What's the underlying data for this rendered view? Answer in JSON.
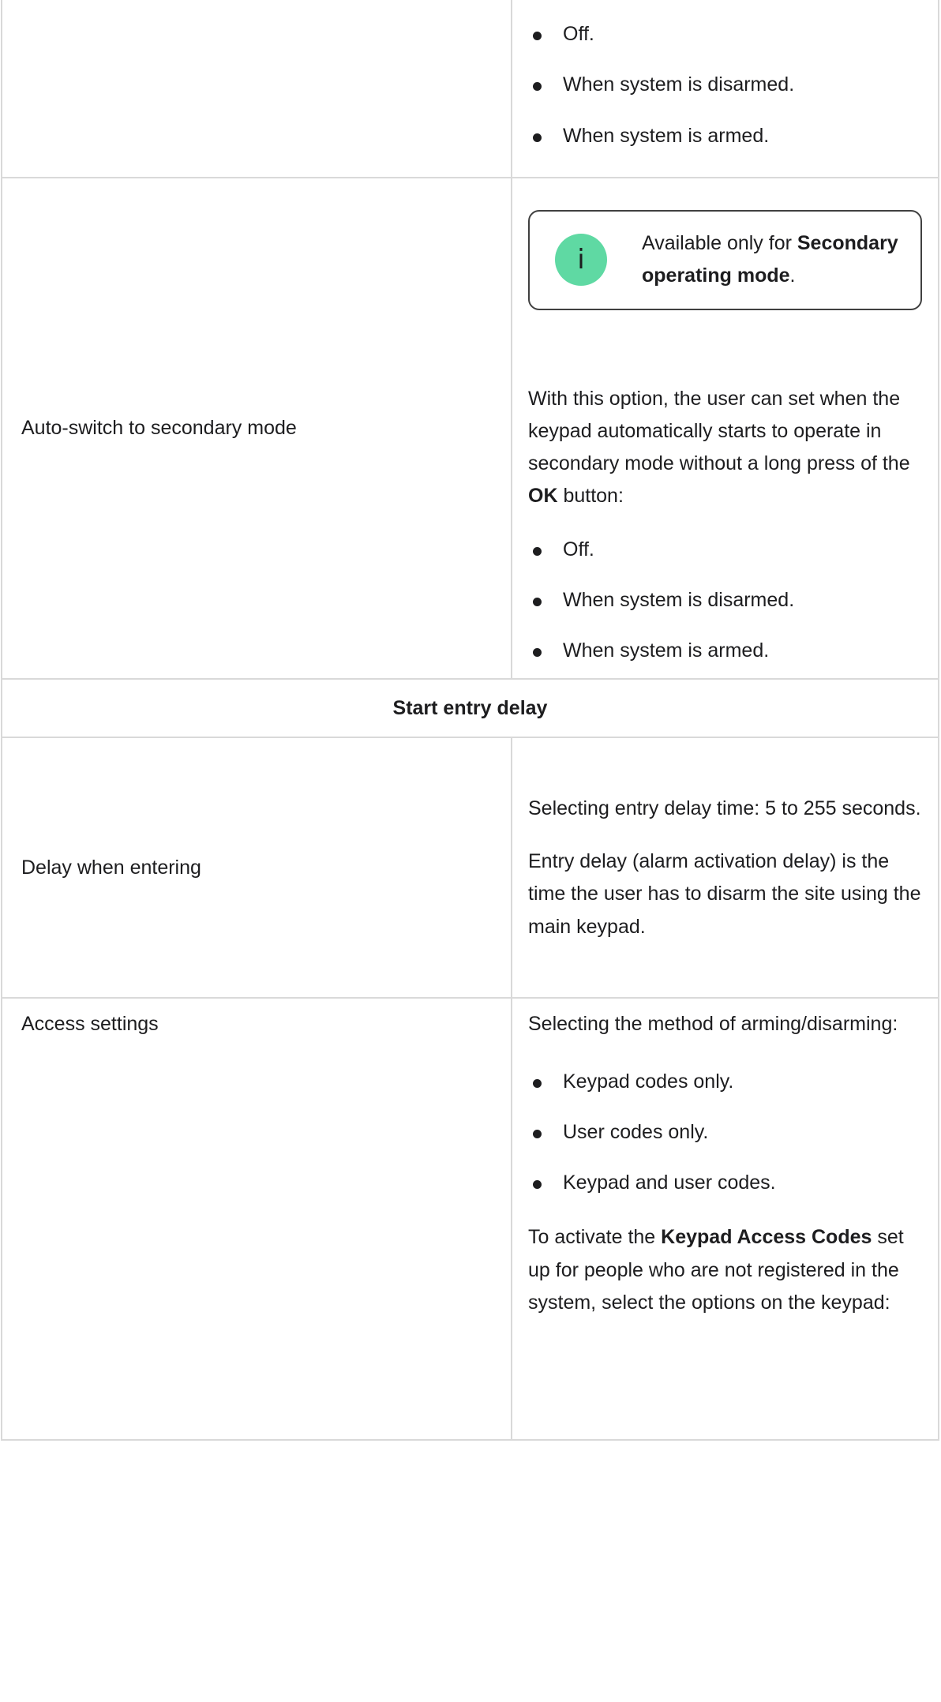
{
  "rows": {
    "arming_light_cont": {
      "options": [
        "Off.",
        "When system is disarmed.",
        "When system is armed."
      ]
    },
    "auto_switch": {
      "name": "Auto-switch to secondary mode",
      "note_prefix": "Available only for ",
      "note_bold": "Secondary operating mode",
      "note_suffix": ".",
      "note_icon": "info-icon",
      "desc_prefix": "With this option, the user can set when the keypad automatically starts to operate in secondary mode without a long press of the ",
      "desc_bold": "OK",
      "desc_suffix": " button:",
      "options": [
        "Off.",
        "When system is disarmed.",
        "When system is armed."
      ]
    },
    "section_entry": {
      "title": "Start entry delay"
    },
    "delay_entering": {
      "name": "Delay when entering",
      "desc1": "Selecting entry delay time: 5 to 255 seconds.",
      "desc2": "Entry delay (alarm activation delay) is the time the user has to disarm the site using the main keypad."
    },
    "access_settings": {
      "name": "Access settings",
      "desc1": "Selecting the method of arming/disarming:",
      "options": [
        "Keypad codes only.",
        "User codes only.",
        "Keypad and user codes."
      ],
      "desc2_prefix": "To activate the ",
      "desc2_bold": "Keypad Access Codes",
      "desc2_suffix": " set up for people who are not registered in the system, select the options on the keypad:"
    }
  },
  "colors": {
    "border": "#d9d9d9",
    "note_border": "#404040",
    "info_icon": "#5fd9a3"
  }
}
